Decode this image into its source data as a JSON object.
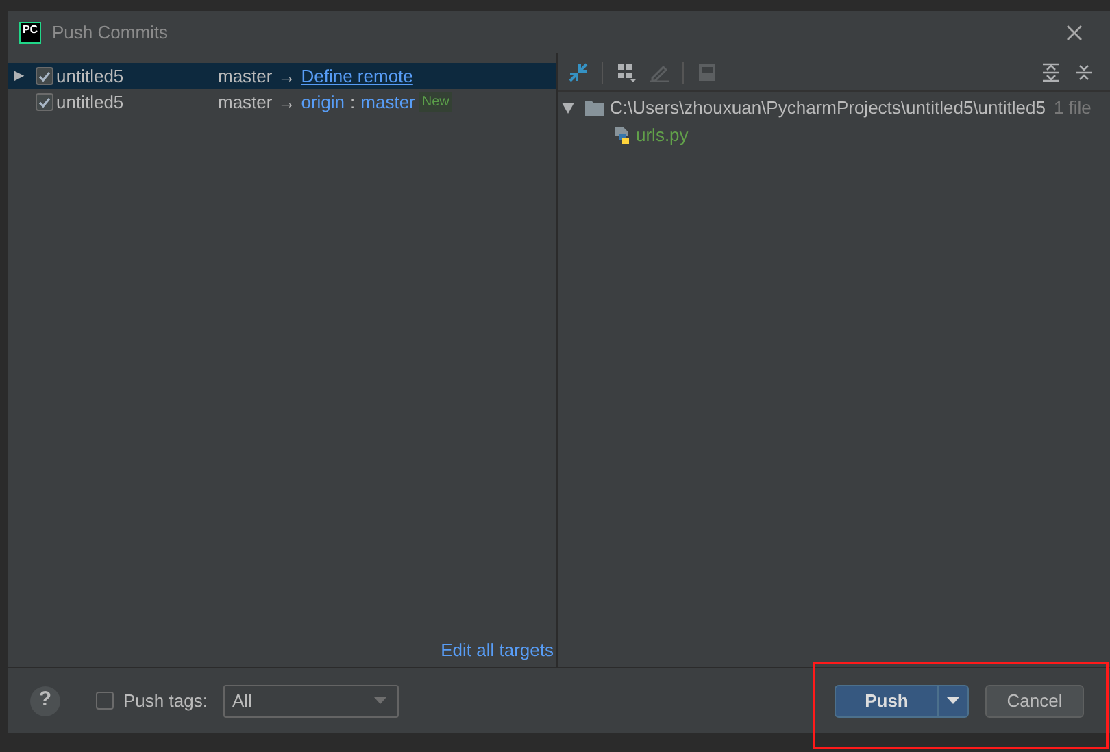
{
  "window": {
    "title": "Push Commits",
    "logo": "PC"
  },
  "repositories": [
    {
      "name": "untitled5",
      "checked": true,
      "selected": true,
      "expander": "▶",
      "branch": "master",
      "arrow": "→",
      "target": {
        "kind": "link",
        "text": "Define remote"
      }
    },
    {
      "name": "untitled5",
      "checked": true,
      "selected": false,
      "branch": "master",
      "arrow": "→",
      "target": {
        "kind": "remote",
        "remote": "origin",
        "separator": ":",
        "branch": "master",
        "badge": "New"
      }
    }
  ],
  "edit_all_targets": "Edit all targets",
  "changes": {
    "tree": [
      {
        "expanded": true,
        "path": "C:\\Users\\zhouxuan\\PycharmProjects\\untitled5\\untitled5",
        "count": "1 file",
        "children": [
          {
            "name": "urls.py"
          }
        ]
      }
    ]
  },
  "footer": {
    "help": "?",
    "push_tags": {
      "label": "Push tags:",
      "checked": false
    },
    "tags_dropdown": {
      "value": "All"
    },
    "buttons": [
      {
        "kind": "primary",
        "label": "Push"
      },
      {
        "kind": "secondary",
        "label": "Cancel"
      }
    ]
  },
  "annotation": {
    "visible": true
  }
}
